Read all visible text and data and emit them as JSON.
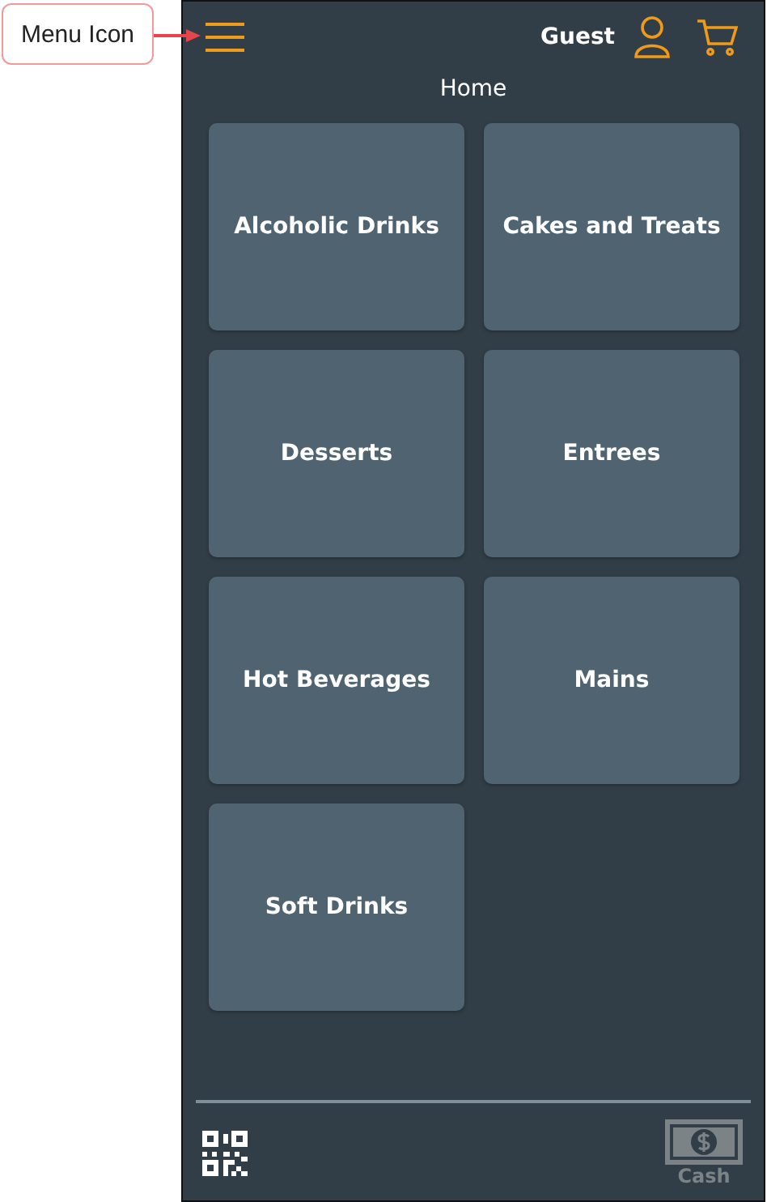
{
  "annotation": {
    "label": "Menu Icon"
  },
  "header": {
    "user": "Guest",
    "title": "Home"
  },
  "categories": [
    {
      "label": "Alcoholic Drinks"
    },
    {
      "label": "Cakes and Treats"
    },
    {
      "label": "Desserts"
    },
    {
      "label": "Entrees"
    },
    {
      "label": "Hot Beverages"
    },
    {
      "label": "Mains"
    },
    {
      "label": "Soft Drinks"
    }
  ],
  "footer": {
    "payment": "Cash"
  }
}
